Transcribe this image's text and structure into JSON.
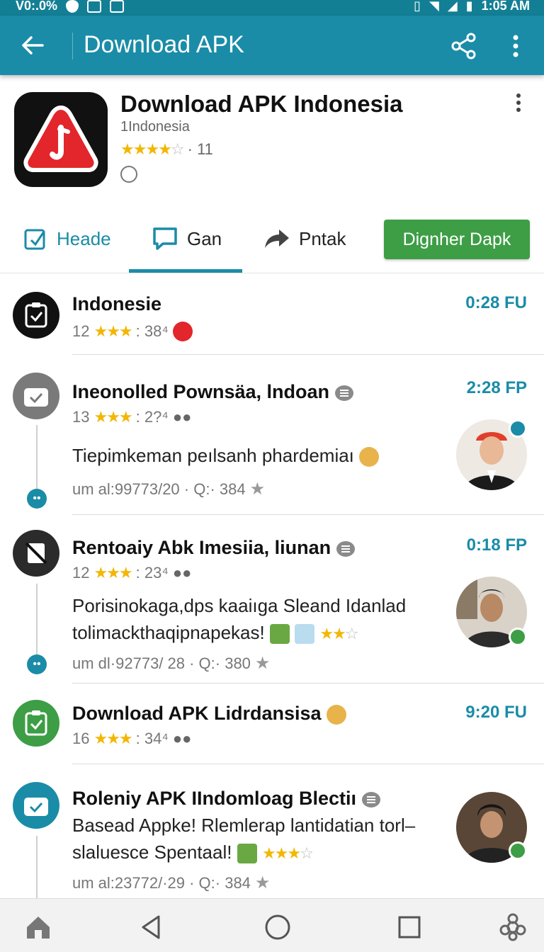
{
  "status_bar": {
    "left_text": "V0:.0%",
    "time": "1:05 AM"
  },
  "app_bar": {
    "title": "Download APK",
    "icons": [
      "back-arrow-icon",
      "share-icon",
      "more-vert-icon"
    ]
  },
  "app": {
    "name": "Download APK Indonesia",
    "subtitle": "1Indonesia",
    "stars": "★★★★",
    "star_empty": "☆",
    "rating_count": "· 11",
    "accent": "#1a8ca7",
    "icon_color": "#e2262c"
  },
  "tabs": [
    {
      "label": "Heade",
      "icon": "clipboard-icon",
      "active": false
    },
    {
      "label": "Gan",
      "icon": "chat-bubble-icon",
      "active": true
    },
    {
      "label": "Pntak",
      "icon": "forward-arrow-icon",
      "active": false
    }
  ],
  "primary_button": {
    "label": "Dignher Dapk",
    "color": "#3d9e45"
  },
  "list": [
    {
      "title": "Indonesie",
      "meta_num": "12",
      "stars": "★★★",
      "meta_suffix": ": 38⁴",
      "time": "0:28 FU",
      "avatar_color": "#111111"
    },
    {
      "title": "Ineonolled  Pownsäa, lndoan",
      "meta_num": "13",
      "stars": "★★★",
      "meta_suffix": ": 2?⁴",
      "time": "2:28 FP",
      "body": "Tiepimkeman peılsanh phardemiaı",
      "foot_text": "um al:99773/20 · Q:· 384",
      "avatar_color": "#7a7a7a"
    },
    {
      "title": "Rentoaiy Abk Imesiia, liunan",
      "meta_num": "12",
      "stars": "★★★",
      "meta_suffix": ": 23⁴",
      "time": "0:18 FP",
      "body": "Porisinokaga,dps kaaiıga Sleand Idanlad tolimackthaqipnapekas!",
      "body_stars": "★★",
      "foot_text": "um dl·92773/ 28 · Q:· 380",
      "avatar_color": "#2b2b2b"
    },
    {
      "title": "Download APK Lidrdansisa",
      "meta_num": "16",
      "stars": "★★★",
      "meta_suffix": ": 34⁴",
      "time": "9:20 FU",
      "avatar_color": "#3d9e45"
    },
    {
      "title": "Roleniy APK IIndomloag Blectiı",
      "body": "Basead Appke! Rlemlerap lantidatian torl– slaluesce Spentaal!",
      "body_stars": "★★★",
      "foot_text": "um al:23772/·29 · Q:· 384",
      "avatar_color": "#1a8ca7"
    }
  ],
  "navbar": {
    "icons": [
      "home-icon",
      "back-triangle-icon",
      "home-circle-icon",
      "recents-square-icon",
      "settings-icon"
    ]
  }
}
